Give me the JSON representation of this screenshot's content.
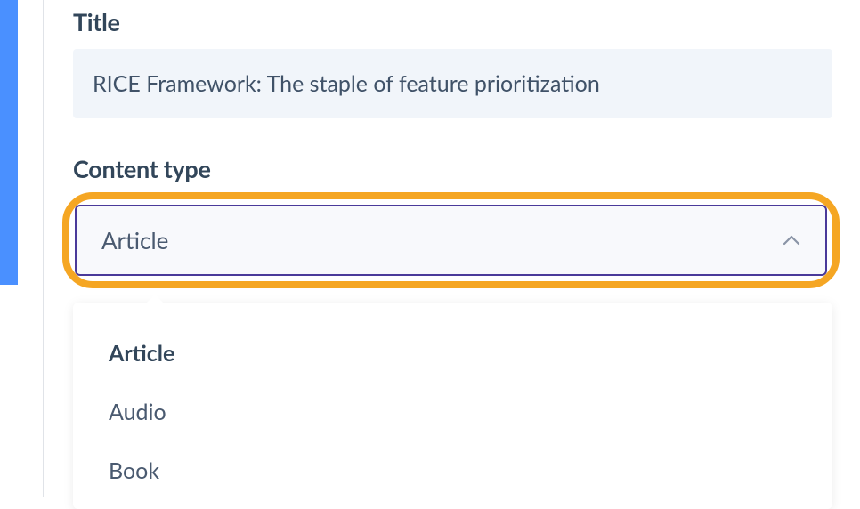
{
  "form": {
    "title": {
      "label": "Title",
      "value": "RICE Framework: The staple of feature prioritization"
    },
    "content_type": {
      "label": "Content type",
      "selected": "Article",
      "options": [
        "Article",
        "Audio",
        "Book"
      ]
    }
  }
}
